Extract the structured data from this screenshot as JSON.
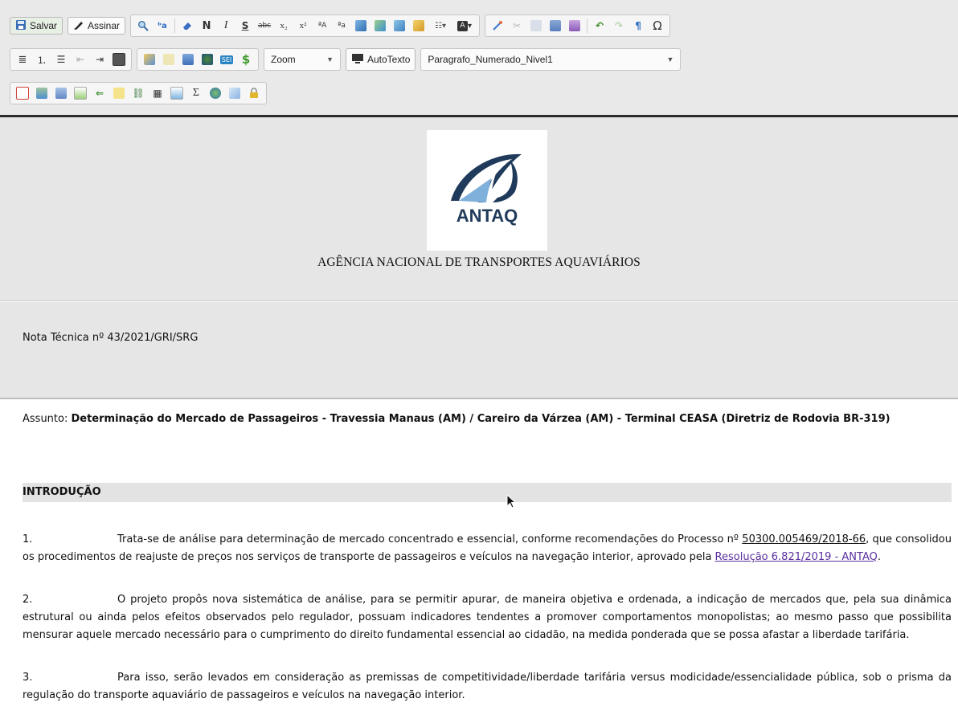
{
  "toolbar": {
    "save_label": "Salvar",
    "sign_label": "Assinar",
    "bold_glyph": "N",
    "italic_glyph": "I",
    "underline_glyph": "S",
    "strike_glyph": "abc",
    "subscript_glyph": "x₂",
    "superscript_glyph": "x²",
    "omega_glyph": "Ω",
    "dollar_glyph": "$",
    "sigma_glyph": "Σ",
    "zoom_label": "Zoom",
    "autotext_label": "AutoTexto",
    "style_value": "Paragrafo_Numerado_Nivel1"
  },
  "header": {
    "logo_text": "ANTAQ",
    "agency_name": "AGÊNCIA NACIONAL DE TRANSPORTES AQUAVIÁRIOS"
  },
  "nota": {
    "title": "Nota Técnica nº 43/2021/GRI/SRG"
  },
  "assunto": {
    "label": "Assunto: ",
    "text": "Determinação do Mercado de Passageiros - Travessia Manaus (AM) / Careiro da Várzea (AM) - Terminal CEASA (Diretriz de Rodovia BR-319)"
  },
  "section": {
    "title": "INTRODUÇÃO"
  },
  "paragraphs": [
    {
      "num": "1.",
      "text_a": "Trata-se de análise para determinação de mercado concentrado e essencial, conforme recomendações do Processo nº ",
      "process": "50300.005469/2018-66",
      "text_b": ", que consolidou os procedimentos de reajuste de preços nos serviços de transporte de passageiros e veículos na navegação interior, aprovado pela ",
      "link": "Resolução 6.821/2019 - ANTAQ",
      "text_c": "."
    },
    {
      "num": "2.",
      "text": "O projeto propôs nova sistemática de análise, para se permitir apurar, de maneira objetiva e ordenada, a indicação de mercados que, pela sua dinâmica estrutural ou ainda pelos efeitos observados pelo regulador, possuam indicadores tendentes a promover comportamentos monopolistas; ao mesmo passo que possibilita mensurar aquele mercado necessário para o cumprimento do direito fundamental essencial ao cidadão, na medida ponderada que se possa afastar a liberdade tarifária."
    },
    {
      "num": "3.",
      "text": "Para isso, serão levados em consideração as premissas de competitividade/liberdade tarifária versus modicidade/essencialidade pública, sob o prisma da regulação do transporte aquaviário de passageiros e veículos na navegação interior."
    }
  ],
  "colors": {
    "link": "#5a2fa0",
    "toolbar_bg": "#e9e9e9",
    "header_bg": "#e6e6e6",
    "logo_navy": "#1f3a5a",
    "logo_blue": "#7fb0dc"
  }
}
